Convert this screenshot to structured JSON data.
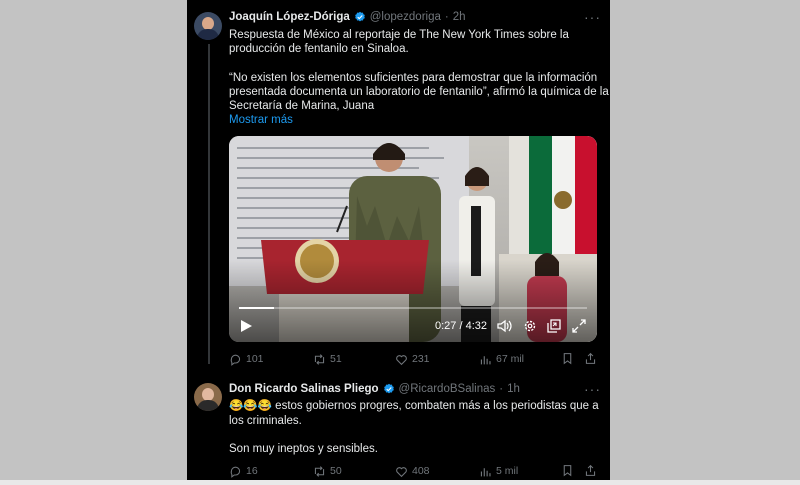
{
  "tweet1": {
    "author_name": "Joaquín López-Dóriga",
    "handle": "@lopezdoriga",
    "separator": "·",
    "time": "2h",
    "more": "···",
    "lines": [
      "Respuesta de México al reportaje de The New York Times sobre la",
      "producción de fentanilo en Sinaloa.",
      "",
      "“No existen los elementos suficientes para demostrar que la información",
      "presentada documenta un laboratorio de fentanilo”, afirmó la química de la",
      "Secretaría de Marina, Juana"
    ],
    "show_more": "Mostrar más",
    "video": {
      "current_time": "0:27",
      "time_sep": "/",
      "duration": "4:32",
      "progress_fraction": 0.1
    },
    "actions": {
      "replies": "101",
      "reposts": "51",
      "likes": "231",
      "views": "67 mil"
    }
  },
  "tweet2": {
    "author_name": "Don Ricardo Salinas Pliego",
    "handle": "@RicardoBSalinas",
    "separator": "·",
    "time": "1h",
    "more": "···",
    "emoji": "😂😂😂",
    "lines": [
      "estos gobiernos progres, combaten más a los periodistas que a",
      "los criminales.",
      "",
      "Son muy ineptos y sensibles."
    ],
    "actions": {
      "replies": "16",
      "reposts": "50",
      "likes": "408",
      "views": "5 mil"
    }
  },
  "colors": {
    "background": "#000000",
    "text": "#e7e9ea",
    "muted": "#71767b",
    "link": "#1d9bf0",
    "verified": "#1d9bf0"
  }
}
